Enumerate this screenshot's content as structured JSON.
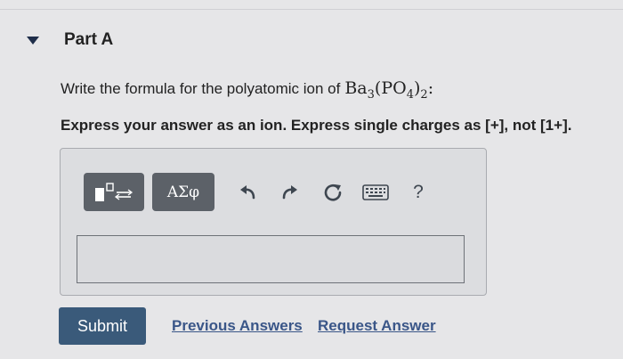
{
  "part": {
    "title": "Part A"
  },
  "question": {
    "text": "Write the formula for the polyatomic ion of ",
    "formula": {
      "ba": "Ba",
      "ba_sub": "3",
      "paren_open": "(",
      "po": "PO",
      "po_sub": "4",
      "paren_close": ")",
      "outer_sub": "2",
      "colon": ":"
    }
  },
  "instruction": "Express your answer as an ion. Express single charges as [+], not [1+].",
  "toolbar": {
    "greek_label": "ΑΣφ",
    "help_label": "?",
    "icons": [
      "templates-icon",
      "undo-icon",
      "redo-icon",
      "reset-icon",
      "keyboard-icon",
      "help-icon"
    ]
  },
  "answer": {
    "value": ""
  },
  "actions": {
    "submit_label": "Submit",
    "previous_answers_label": "Previous Answers",
    "request_answer_label": "Request Answer"
  },
  "colors": {
    "submit_bg": "#3a5a7a",
    "tool_bg": "#5c6168",
    "link": "#3a5688"
  }
}
